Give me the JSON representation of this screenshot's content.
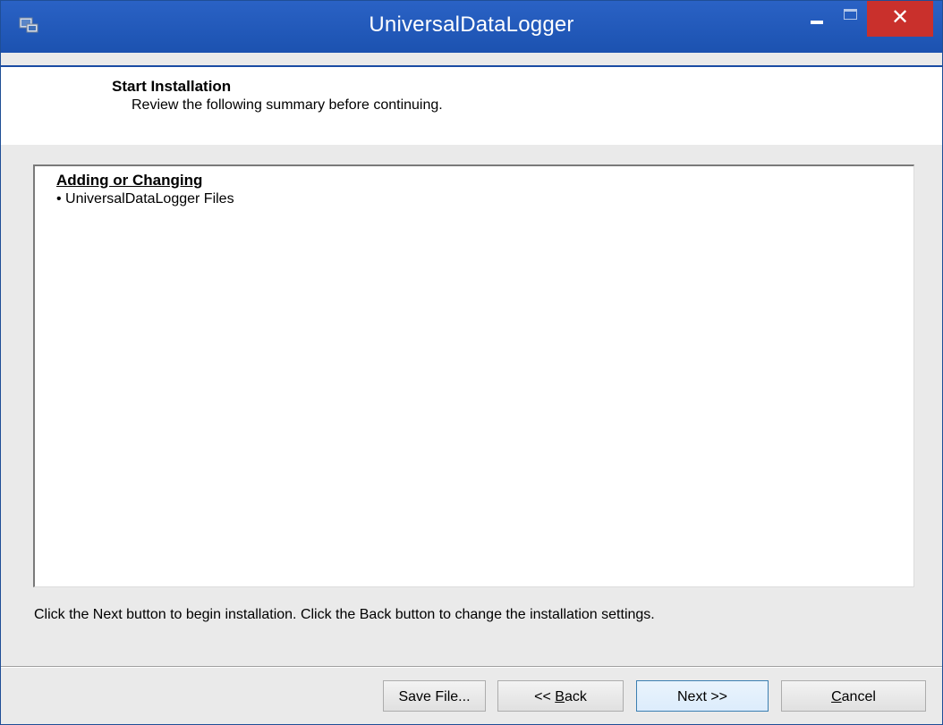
{
  "window": {
    "title": "UniversalDataLogger",
    "icon": "installer-app-icon",
    "controls": {
      "minimize_icon": "minimize-icon",
      "maximize_icon": "maximize-icon",
      "close_glyph": "✕"
    }
  },
  "header": {
    "title": "Start Installation",
    "subtitle": "Review the following summary before continuing."
  },
  "summary": {
    "heading": "Adding or Changing",
    "items": [
      "• UniversalDataLogger Files"
    ]
  },
  "instruction": "Click the Next button to begin installation.  Click the Back button to change the installation settings.",
  "buttons": {
    "save": "Save File...",
    "back_prefix": "<< ",
    "back_mnemonic": "B",
    "back_rest": "ack",
    "next": "Next >>",
    "cancel_mnemonic": "C",
    "cancel_rest": "ancel"
  },
  "colors": {
    "titlebar": "#1f56b5",
    "close": "#c9302c",
    "default_button_border": "#3c7fb1"
  }
}
